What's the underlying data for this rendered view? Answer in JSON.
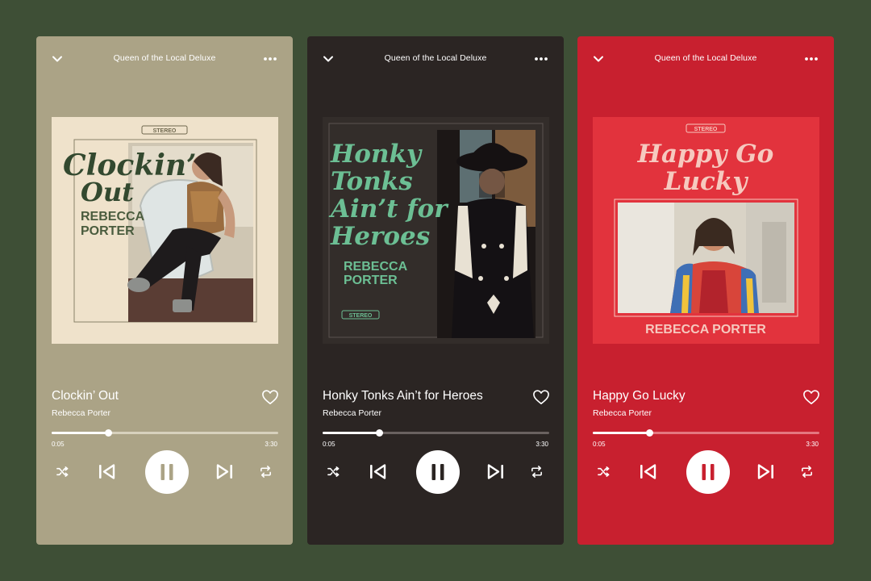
{
  "players": [
    {
      "album_title": "Queen of the Local Deluxe",
      "song_title": "Clockin’ Out",
      "artist": "Rebecca Porter",
      "elapsed": "0:05",
      "total": "3:30",
      "progress": 0.25,
      "colors": {
        "bg": "#aba386",
        "text": "#ffffff",
        "track": "#d7d1bd",
        "fill": "#ffffff"
      },
      "cover": {
        "title_lines": [
          "Clockin’",
          "Out"
        ],
        "artist_lines": [
          "REBECCA",
          "PORTER"
        ],
        "stamp": "STEREO",
        "colors": {
          "paper": "#efe2cb",
          "title": "#33492f",
          "artist": "#4a5c3e",
          "photo": "#cfc6b3"
        }
      }
    },
    {
      "album_title": "Queen of the Local Deluxe",
      "song_title": "Honky Tonks Ain’t for Heroes",
      "artist": "Rebecca Porter",
      "elapsed": "0:05",
      "total": "3:30",
      "progress": 0.25,
      "colors": {
        "bg": "#2b2523",
        "text": "#ffffff",
        "track": "#6a6260",
        "fill": "#ffffff"
      },
      "cover": {
        "title_lines": [
          "Honky",
          "Tonks",
          "Ain’t for",
          "Heroes"
        ],
        "artist_lines": [
          "REBECCA",
          "PORTER"
        ],
        "stamp": "STEREO",
        "colors": {
          "paper": "#332d2a",
          "title": "#6cbf94",
          "artist": "#6cbf94",
          "photo": "#1c1716"
        }
      }
    },
    {
      "album_title": "Queen of the Local Deluxe",
      "song_title": "Happy Go Lucky",
      "artist": "Rebecca Porter",
      "elapsed": "0:05",
      "total": "3:30",
      "progress": 0.25,
      "colors": {
        "bg": "#c8202f",
        "text": "#ffffff",
        "track": "#e47780",
        "fill": "#ffffff"
      },
      "cover": {
        "title_lines": [
          "Happy Go",
          "Lucky"
        ],
        "artist_lines": [
          "REBECCA PORTER"
        ],
        "stamp": "STEREO",
        "colors": {
          "paper": "#e2333d",
          "title": "#f6c9bf",
          "artist": "#f6c9bf",
          "photo": "#d9d3c6"
        }
      }
    }
  ],
  "icons": {
    "collapse": "chevron-down-icon",
    "options": "more-dots-icon",
    "like": "heart-icon",
    "shuffle": "shuffle-icon",
    "previous": "skip-previous-icon",
    "pause": "pause-icon",
    "next": "skip-next-icon",
    "repeat": "repeat-icon"
  }
}
